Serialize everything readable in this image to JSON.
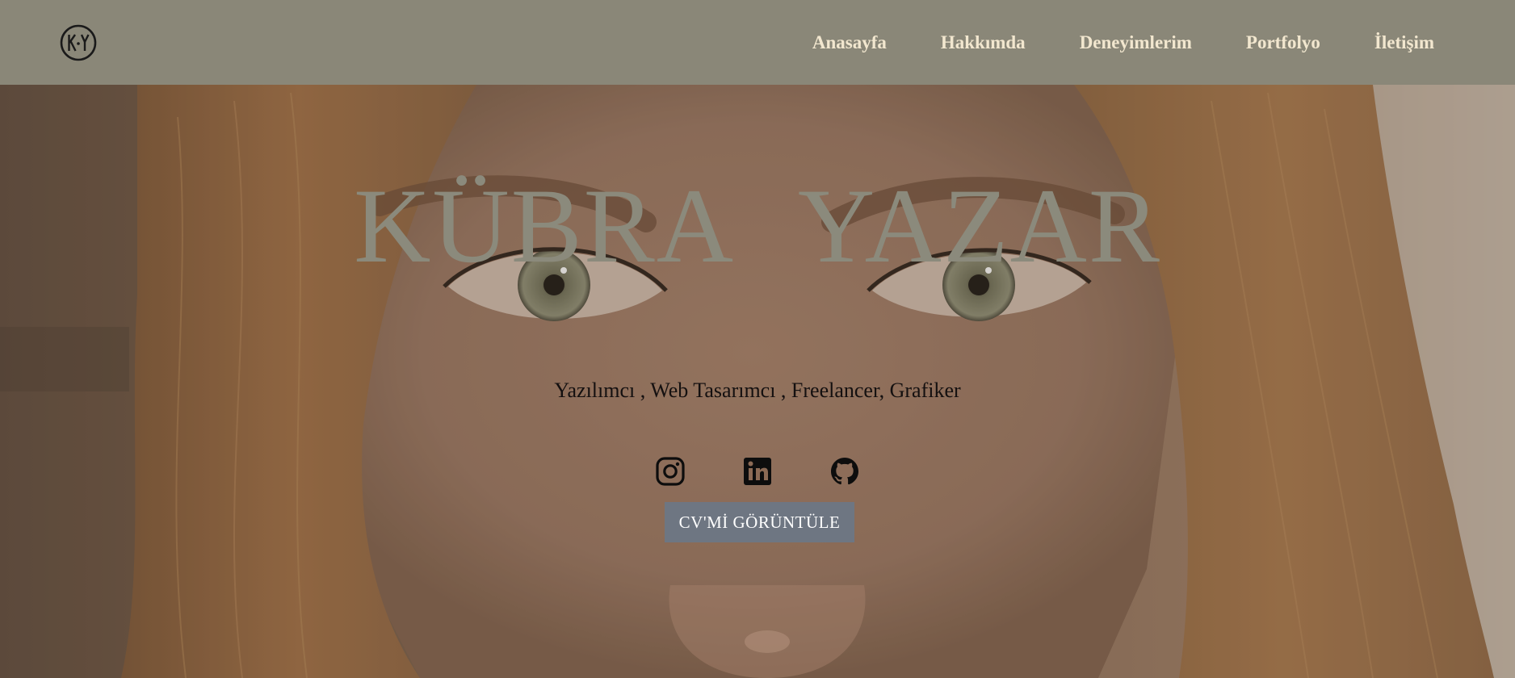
{
  "header": {
    "logo_text": "K·Y",
    "nav": [
      {
        "label": "Anasayfa"
      },
      {
        "label": "Hakkımda"
      },
      {
        "label": "Deneyimlerim"
      },
      {
        "label": "Portfolyo"
      },
      {
        "label": "İletişim"
      }
    ]
  },
  "hero": {
    "title": "KÜBRA YAZAR",
    "subtitle": "Yazılımcı , Web Tasarımcı , Freelancer, Grafiker",
    "social": [
      {
        "icon": "instagram-icon"
      },
      {
        "icon": "linkedin-icon"
      },
      {
        "icon": "github-icon"
      }
    ],
    "cv_button": "CV'Mİ GÖRÜNTÜLE"
  },
  "colors": {
    "header_bg": "#8a8778",
    "nav_text": "#f2e7cf",
    "title": "#8b8a7c",
    "button_bg": "#6e7682"
  }
}
